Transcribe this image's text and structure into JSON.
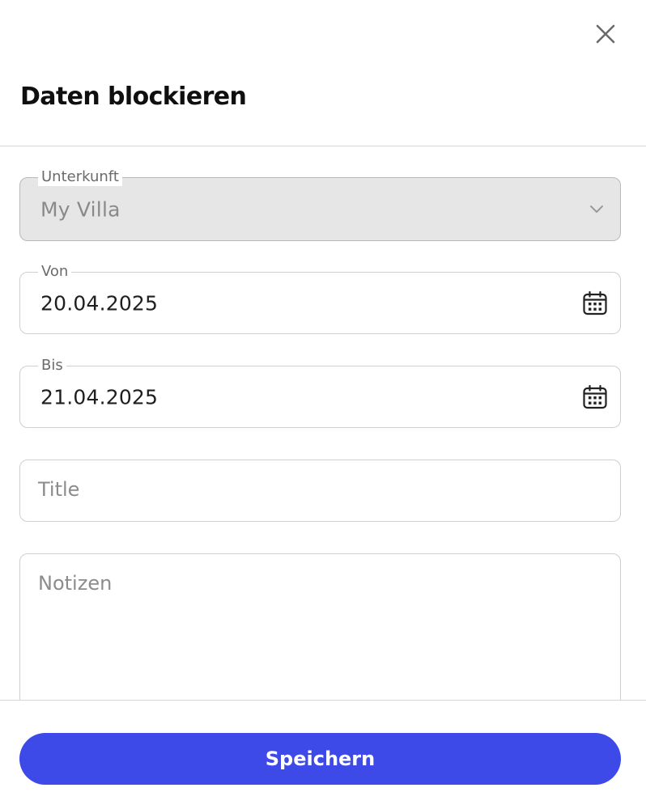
{
  "dialog": {
    "title": "Daten blockieren",
    "close_icon": "close-icon"
  },
  "form": {
    "accommodation": {
      "label": "Unterkunft",
      "value": "My Villa",
      "disabled": true,
      "icon": "chevron-down-icon"
    },
    "from": {
      "label": "Von",
      "value": "20.04.2025",
      "icon": "calendar-icon"
    },
    "to": {
      "label": "Bis",
      "value": "21.04.2025",
      "icon": "calendar-icon"
    },
    "title_field": {
      "placeholder": "Title"
    },
    "notes": {
      "placeholder": "Notizen"
    }
  },
  "footer": {
    "save_label": "Speichern"
  },
  "colors": {
    "primary": "#3d4ae8",
    "disabled_bg": "#e6e6e6",
    "border": "#cfcfcf"
  }
}
